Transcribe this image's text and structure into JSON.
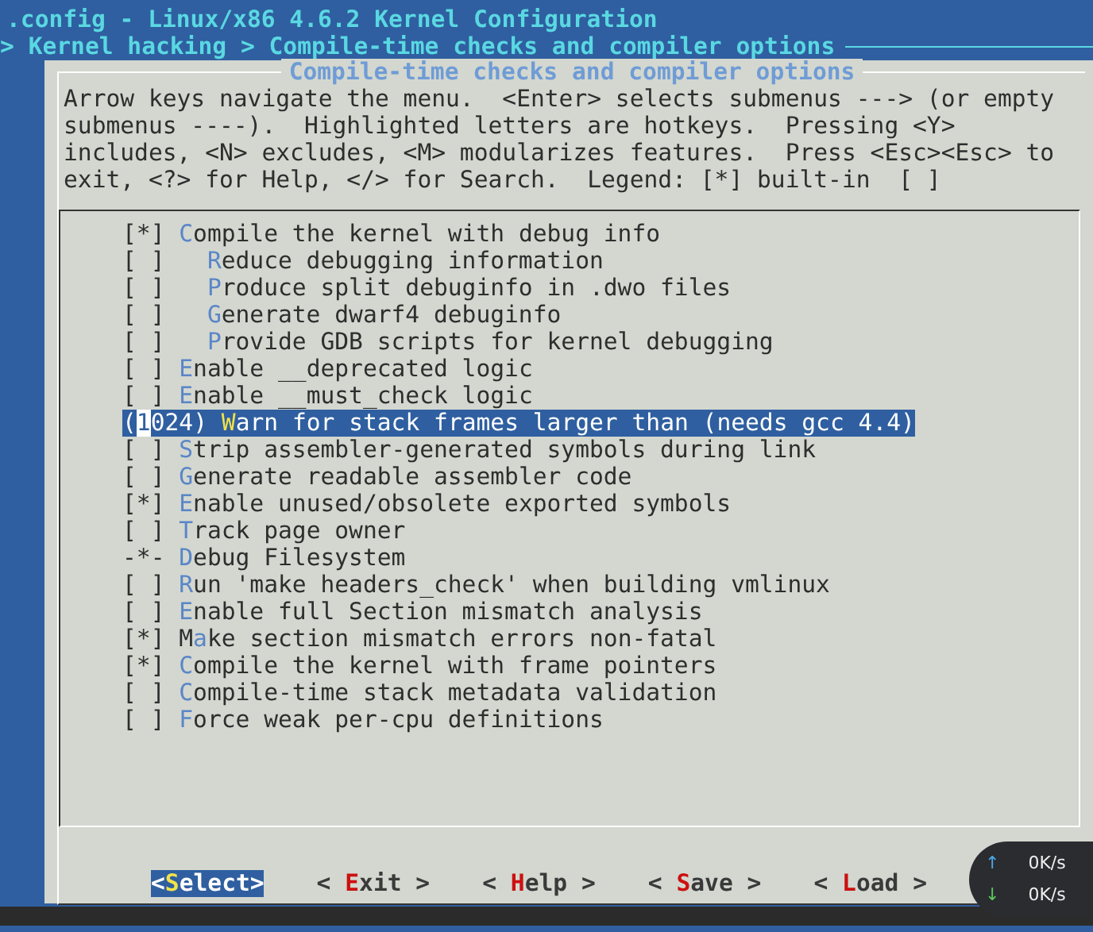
{
  "window": {
    "title": ".config - Linux/x86 4.6.2 Kernel Configuration"
  },
  "breadcrumb": "> Kernel hacking > Compile-time checks and compiler options",
  "dialog": {
    "title": "Compile-time checks and compiler options",
    "help_lines": [
      "Arrow keys navigate the menu.  <Enter> selects submenus ---> (or empty",
      "submenus ----).  Highlighted letters are hotkeys.  Pressing <Y>",
      "includes, <N> excludes, <M> modularizes features.  Press <Esc><Esc> to",
      "exit, <?> for Help, </> for Search.  Legend: [*] built-in  [ ]"
    ],
    "items": [
      {
        "kind": "bool",
        "marker": "[*]",
        "hotkey": "C",
        "label_end": "ompile the kernel with debug info",
        "selected": false,
        "children": [
          {
            "kind": "bool",
            "marker": "[ ]",
            "hotkey": "R",
            "label_end": "educe debugging information",
            "selected": false
          },
          {
            "kind": "bool",
            "marker": "[ ]",
            "hotkey": "P",
            "label_end": "roduce split debuginfo in .dwo files",
            "selected": false
          },
          {
            "kind": "bool",
            "marker": "[ ]",
            "hotkey": "G",
            "label_end": "enerate dwarf4 debuginfo",
            "selected": false
          },
          {
            "kind": "bool",
            "marker": "[ ]",
            "hotkey": "P",
            "label_end": "rovide GDB scripts for kernel debugging",
            "selected": false
          }
        ]
      },
      {
        "kind": "bool",
        "marker": "[ ]",
        "hotkey": "E",
        "label_end": "nable __deprecated logic",
        "selected": false
      },
      {
        "kind": "bool",
        "marker": "[ ]",
        "hotkey": "E",
        "label_end": "nable __must_check logic",
        "selected": false
      },
      {
        "kind": "value",
        "marker": "(1024)",
        "hotkey": "W",
        "label_end": "arn for stack frames larger than (needs gcc 4.4)",
        "selected": true
      },
      {
        "kind": "bool",
        "marker": "[ ]",
        "hotkey": "S",
        "label_end": "trip assembler-generated symbols during link",
        "selected": false
      },
      {
        "kind": "bool",
        "marker": "[ ]",
        "hotkey": "G",
        "label_end": "enerate readable assembler code",
        "selected": false
      },
      {
        "kind": "bool",
        "marker": "[*]",
        "hotkey": "E",
        "label_end": "nable unused/obsolete exported symbols",
        "selected": false
      },
      {
        "kind": "bool",
        "marker": "[ ]",
        "hotkey": "T",
        "label_end": "rack page owner",
        "selected": false
      },
      {
        "kind": "forced",
        "marker": "-*-",
        "hotkey": "D",
        "label_end": "ebug Filesystem",
        "selected": false
      },
      {
        "kind": "bool",
        "marker": "[ ]",
        "hotkey": "R",
        "label_end": "un 'make headers_check' when building vmlinux",
        "selected": false
      },
      {
        "kind": "bool",
        "marker": "[ ]",
        "hotkey": "E",
        "label_end": "nable full Section mismatch analysis",
        "selected": false
      },
      {
        "kind": "bool",
        "marker": "[*]",
        "label_start": "M",
        "hotkey": "a",
        "label_end": "ke section mismatch errors non-fatal",
        "selected": false
      },
      {
        "kind": "bool",
        "marker": "[*]",
        "hotkey": "C",
        "label_end": "ompile the kernel with frame pointers",
        "selected": false
      },
      {
        "kind": "bool",
        "marker": "[ ]",
        "hotkey": "C",
        "label_end": "ompile-time stack metadata validation",
        "selected": false
      },
      {
        "kind": "bool",
        "marker": "[ ]",
        "hotkey": "F",
        "label_end": "orce weak per-cpu definitions",
        "selected": false
      }
    ],
    "buttons": [
      {
        "label_start": "<",
        "hotkey": "S",
        "label_end": "elect>",
        "selected": true
      },
      {
        "label_start": "< ",
        "hotkey": "E",
        "label_end": "xit >",
        "selected": false
      },
      {
        "label_start": "< ",
        "hotkey": "H",
        "label_end": "elp >",
        "selected": false
      },
      {
        "label_start": "< ",
        "hotkey": "S",
        "label_end": "ave >",
        "selected": false
      },
      {
        "label_start": "< ",
        "hotkey": "L",
        "label_end": "oad >",
        "selected": false
      }
    ]
  },
  "network_widget": {
    "upload_icon": "↑",
    "upload": "0K/s",
    "download_icon": "↓",
    "download": "0K/s"
  }
}
